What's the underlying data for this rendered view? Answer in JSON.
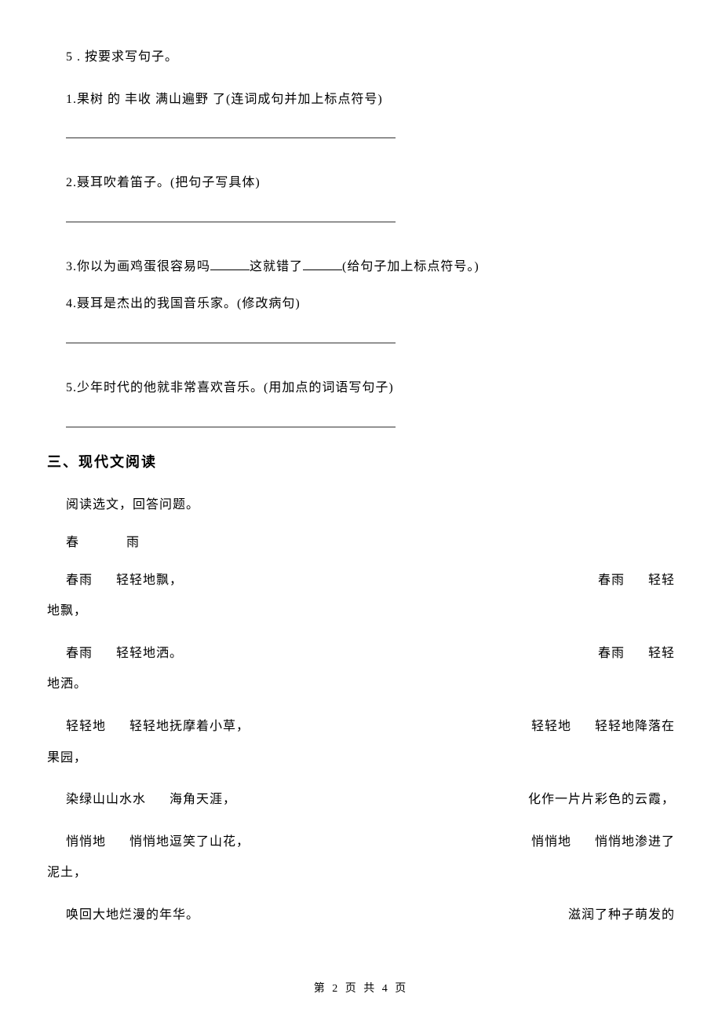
{
  "q5": {
    "title": "5 . 按要求写句子。",
    "items": [
      "1.果树  的  丰收  满山遍野  了(连词成句并加上标点符号)",
      "2.聂耳吹着笛子。(把句子写具体)",
      "4.聂耳是杰出的我国音乐家。(修改病句)",
      "5.少年时代的他就非常喜欢音乐。(用加点的词语写句子)"
    ],
    "item3_pre": "3.你以为画鸡蛋很容易吗",
    "item3_mid": "这就错了",
    "item3_post": "(给句子加上标点符号。)"
  },
  "section3": {
    "heading": "三、现代文阅读",
    "intro": "阅读选文，回答问题。",
    "title_a": "春",
    "title_b": "雨",
    "lines": [
      {
        "l1": "春雨",
        "l2": "轻轻地飘，",
        "r1": "春雨",
        "r2": "轻轻",
        "wrap": "地飘，"
      },
      {
        "l1": "春雨",
        "l2": "轻轻地洒。",
        "r1": "春雨",
        "r2": "轻轻",
        "wrap": "地洒。"
      },
      {
        "l1": "轻轻地",
        "l2": "轻轻地抚摩着小草，",
        "r1": "轻轻地",
        "r2": "轻轻地降落在",
        "wrap": "果园，"
      },
      {
        "l1": "染绿山山水水",
        "l2": "海角天涯，",
        "r_full": "化作一片片彩色的云霞，"
      },
      {
        "l1": "悄悄地",
        "l2": "悄悄地逗笑了山花，",
        "r1": "悄悄地",
        "r2": "悄悄地渗进了",
        "wrap": "泥土，"
      },
      {
        "l_full": "唤回大地烂漫的年华。",
        "r_full": "滋润了种子萌发的"
      }
    ]
  },
  "footer": "第 2 页 共 4 页"
}
